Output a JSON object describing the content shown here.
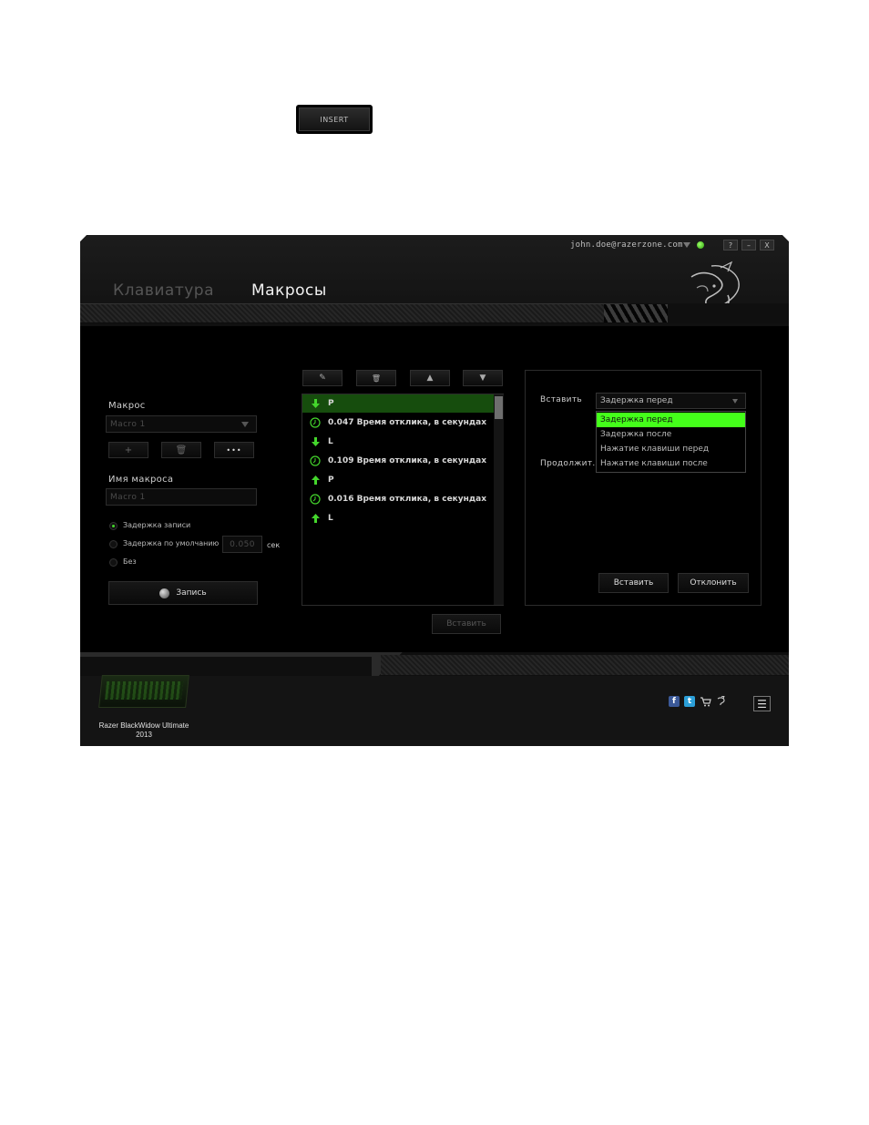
{
  "insert_key": {
    "label": "INSERT"
  },
  "window": {
    "account": "john.doe@razerzone.com",
    "controls": {
      "help": "?",
      "minimize": "–",
      "close": "X"
    },
    "tabs": [
      {
        "label": "Клавиатура",
        "active": false
      },
      {
        "label": "Макросы",
        "active": true
      }
    ],
    "accent_color": "#44d62c"
  },
  "left_panel": {
    "macro_label": "Макрос",
    "macro_select": "Macro 1",
    "buttons": {
      "add": "+",
      "delete": "🗑",
      "more": "•••"
    },
    "macro_name_label": "Имя макроса",
    "macro_name_value": "Macro 1",
    "delay_options": [
      {
        "label": "Задержка записи",
        "selected": true
      },
      {
        "label": "Задержка по умолчанию",
        "selected": false
      },
      {
        "label": "Без",
        "selected": false
      }
    ],
    "default_delay_value": "0.050",
    "delay_unit": "сек",
    "record_button": "Запись"
  },
  "macro_list": {
    "toolbar": {
      "edit": "✎",
      "delete": "🗑",
      "up": "▲",
      "down": "▼"
    },
    "rows": [
      {
        "type": "key-down",
        "text": "P",
        "selected": true
      },
      {
        "type": "delay",
        "text": "0.047 Время отклика, в секундах"
      },
      {
        "type": "key-down",
        "text": "L"
      },
      {
        "type": "delay",
        "text": "0.109 Время отклика, в секундах"
      },
      {
        "type": "key-up",
        "text": "P"
      },
      {
        "type": "delay",
        "text": "0.016 Время отклика, в секундах"
      },
      {
        "type": "key-up",
        "text": "L"
      }
    ],
    "insert_button": "Вставить"
  },
  "insert_panel": {
    "insert_label": "Вставить",
    "select_value": "Задержка перед",
    "options": [
      "Задержка перед",
      "Задержка после",
      "Нажатие клавиши перед",
      "Нажатие клавиши после"
    ],
    "active_option_index": 0,
    "duration_label": "Продолжит...",
    "insert_button": "Вставить",
    "cancel_button": "Отклонить"
  },
  "footer": {
    "device_name_line1": "Razer BlackWidow Ultimate",
    "device_name_line2": "2013",
    "social": [
      "facebook-icon",
      "twitter-icon",
      "cart-icon",
      "razer-icon"
    ],
    "menu_icon": "☰"
  }
}
